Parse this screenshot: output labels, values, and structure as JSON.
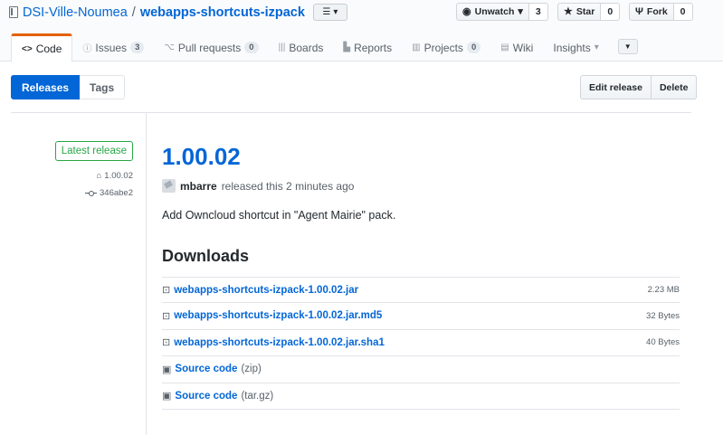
{
  "repo": {
    "owner": "DSI-Ville-Noumea",
    "separator": "/",
    "name": "webapps-shortcuts-izpack"
  },
  "social": {
    "watch_label": "Unwatch",
    "watch_count": "3",
    "star_label": "Star",
    "star_count": "0",
    "fork_label": "Fork",
    "fork_count": "0"
  },
  "tabs": [
    {
      "label": "Code",
      "icon": "code-icon",
      "glyph": "<>"
    },
    {
      "label": "Issues",
      "icon": "issue-icon",
      "glyph": "ⓘ",
      "count": "3"
    },
    {
      "label": "Pull requests",
      "icon": "pull-request-icon",
      "glyph": "⌥",
      "count": "0"
    },
    {
      "label": "Boards",
      "icon": "boards-icon",
      "glyph": "|||"
    },
    {
      "label": "Reports",
      "icon": "graph-icon",
      "glyph": "▙"
    },
    {
      "label": "Projects",
      "icon": "project-icon",
      "glyph": "▥",
      "count": "0"
    },
    {
      "label": "Wiki",
      "icon": "book-icon",
      "glyph": "▤"
    },
    {
      "label": "Insights",
      "icon": "caret-down-icon",
      "glyph": "▾"
    }
  ],
  "subnav": {
    "releases": "Releases",
    "tags": "Tags",
    "edit_release": "Edit release",
    "delete": "Delete"
  },
  "release": {
    "latest_label": "Latest release",
    "tag": "1.00.02",
    "commit": "346abe2",
    "title": "1.00.02",
    "author": "mbarre",
    "released_text": "released this 2 minutes ago",
    "description": "Add Owncloud shortcut in \"Agent Mairie\" pack."
  },
  "downloads": {
    "heading": "Downloads",
    "assets": [
      {
        "name": "webapps-shortcuts-izpack-1.00.02.jar",
        "size": "2.23 MB"
      },
      {
        "name": "webapps-shortcuts-izpack-1.00.02.jar.md5",
        "size": "32 Bytes"
      },
      {
        "name": "webapps-shortcuts-izpack-1.00.02.jar.sha1",
        "size": "40 Bytes"
      }
    ],
    "sources": [
      {
        "label": "Source code",
        "format": "(zip)"
      },
      {
        "label": "Source code",
        "format": "(tar.gz)"
      }
    ]
  }
}
